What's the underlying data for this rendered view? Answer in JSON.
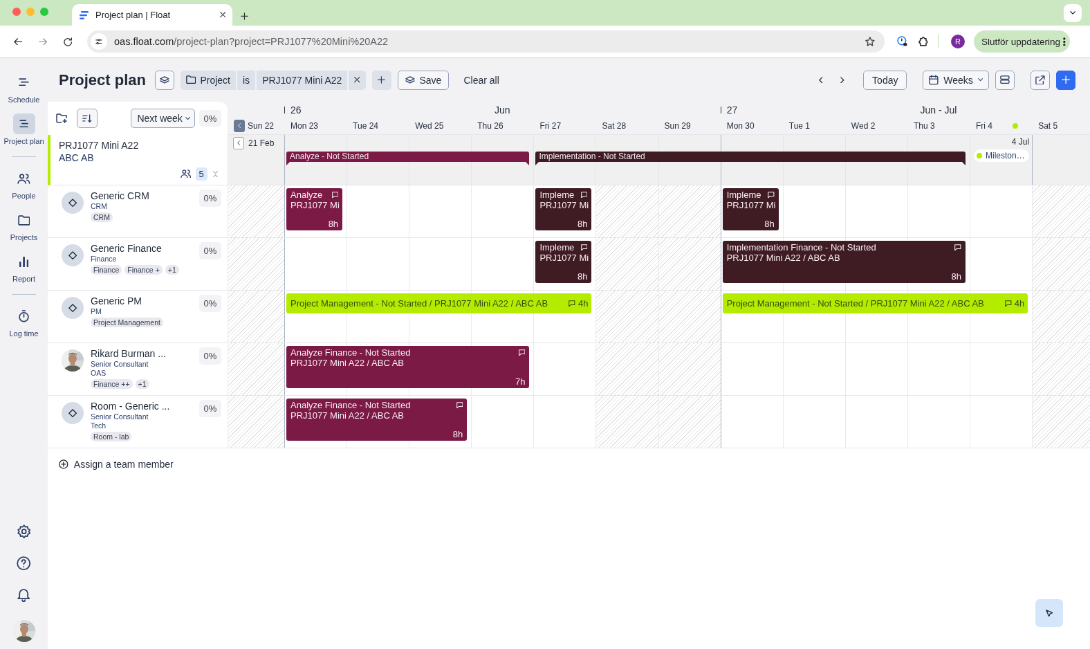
{
  "browser": {
    "tab_title": "Project plan | Float",
    "url_host": "oas.float.com",
    "url_path": "/project-plan?project=PRJ1077%20Mini%20A22",
    "profile_initial": "R",
    "update_button": "Slutför uppdatering"
  },
  "nav": {
    "groups": [
      [
        {
          "label": "Schedule",
          "selected": false
        },
        {
          "label": "Project plan",
          "selected": true
        }
      ],
      [
        {
          "label": "People",
          "selected": false
        },
        {
          "label": "Projects",
          "selected": false
        },
        {
          "label": "Report",
          "selected": false
        }
      ],
      [
        {
          "label": "Log time",
          "selected": false
        }
      ]
    ]
  },
  "header": {
    "title": "Project plan",
    "filter": {
      "field": "Project",
      "operator": "is",
      "value": "PRJ1077 Mini A22"
    },
    "save": "Save",
    "clear": "Clear all",
    "today": "Today",
    "view": "Weeks"
  },
  "panel": {
    "period": "Next week",
    "utilization": "0%",
    "assign": "Assign a team member"
  },
  "project": {
    "name": "PRJ1077 Mini A22",
    "client": "ABC AB",
    "member_count": "5"
  },
  "timeline": {
    "days": [
      {
        "label": "Sun 22",
        "weekend": true,
        "milestone": false
      },
      {
        "label": "Mon 23",
        "weekend": false,
        "milestone": false,
        "week": {
          "number": "26",
          "month": "Jun"
        }
      },
      {
        "label": "Tue 24",
        "weekend": false,
        "milestone": false
      },
      {
        "label": "Wed 25",
        "weekend": false,
        "milestone": false
      },
      {
        "label": "Thu 26",
        "weekend": false,
        "milestone": false
      },
      {
        "label": "Fri 27",
        "weekend": false,
        "milestone": false
      },
      {
        "label": "Sat 28",
        "weekend": true,
        "milestone": false
      },
      {
        "label": "Sun 29",
        "weekend": true,
        "milestone": false
      },
      {
        "label": "Mon 30",
        "weekend": false,
        "milestone": false,
        "week": {
          "number": "27",
          "month": "Jun - Jul"
        }
      },
      {
        "label": "Tue 1",
        "weekend": false,
        "milestone": false
      },
      {
        "label": "Wed 2",
        "weekend": false,
        "milestone": false
      },
      {
        "label": "Thu 3",
        "weekend": false,
        "milestone": false
      },
      {
        "label": "Fri 4",
        "weekend": false,
        "milestone": true
      },
      {
        "label": "Sat 5",
        "weekend": true,
        "milestone": false
      }
    ],
    "project_slots": [
      {
        "kind": "start",
        "label": "21 Feb"
      },
      {
        "kind": "phase",
        "title": "Analyze - Not Started",
        "color": "#7b1a45"
      },
      {
        "kind": "cont"
      },
      {
        "kind": "cont"
      },
      {
        "kind": "cont"
      },
      {
        "kind": "phase",
        "title": "Implementation - Not Started",
        "color": "#3f1c24"
      },
      {
        "kind": "cont"
      },
      {
        "kind": "cont"
      },
      {
        "kind": "cont"
      },
      {
        "kind": "cont"
      },
      {
        "kind": "cont"
      },
      {
        "kind": "cont"
      },
      {
        "kind": "end",
        "label": "4 Jul",
        "milestone": "Mileston…"
      },
      {
        "kind": "free"
      }
    ]
  },
  "people": [
    {
      "name": "Generic CRM",
      "role": "CRM",
      "kind": "placeholder",
      "tags": [
        "CRM"
      ],
      "utilization": "0%",
      "slots": [
        {
          "kind": "free"
        },
        {
          "kind": "block",
          "title": "Analyze",
          "subtitle": "PRJ1077 Mi",
          "hours": "8h",
          "comment": true,
          "color": "#7b1a45"
        },
        {
          "kind": "free"
        },
        {
          "kind": "free"
        },
        {
          "kind": "free"
        },
        {
          "kind": "block",
          "title": "Impleme",
          "subtitle": "PRJ1077 Mi",
          "hours": "8h",
          "comment": true,
          "color": "#3f1c24"
        },
        {
          "kind": "free"
        },
        {
          "kind": "free"
        },
        {
          "kind": "block",
          "title": "Impleme",
          "subtitle": "PRJ1077 Mi",
          "hours": "8h",
          "comment": true,
          "color": "#3f1c24"
        },
        {
          "kind": "free"
        },
        {
          "kind": "free"
        },
        {
          "kind": "free"
        },
        {
          "kind": "free"
        },
        {
          "kind": "free"
        }
      ]
    },
    {
      "name": "Generic Finance",
      "role": "Finance",
      "kind": "placeholder",
      "tags": [
        "Finance",
        "Finance +",
        "+1"
      ],
      "utilization": "0%",
      "slots": [
        {
          "kind": "free"
        },
        {
          "kind": "free"
        },
        {
          "kind": "free"
        },
        {
          "kind": "free"
        },
        {
          "kind": "free"
        },
        {
          "kind": "block",
          "title": "Impleme",
          "subtitle": "PRJ1077 Mi",
          "hours": "8h",
          "comment": true,
          "color": "#3f1c24"
        },
        {
          "kind": "free"
        },
        {
          "kind": "free"
        },
        {
          "kind": "block",
          "title": "Implementation Finance - Not Started",
          "subtitle": "PRJ1077 Mini A22 / ABC AB",
          "hours": "8h",
          "comment": true,
          "color": "#3f1c24"
        },
        {
          "kind": "cont"
        },
        {
          "kind": "cont"
        },
        {
          "kind": "cont"
        },
        {
          "kind": "free"
        },
        {
          "kind": "free"
        }
      ]
    },
    {
      "name": "Generic PM",
      "role": "PM",
      "kind": "placeholder",
      "tags": [
        "Project Management"
      ],
      "utilization": "0%",
      "slots": [
        {
          "kind": "free"
        },
        {
          "kind": "line",
          "title": "Project Management - Not Started / PRJ1077 Mini A22 / ABC AB",
          "hours": "4h",
          "comment": true,
          "color": "#b4ec00"
        },
        {
          "kind": "cont"
        },
        {
          "kind": "cont"
        },
        {
          "kind": "cont"
        },
        {
          "kind": "cont"
        },
        {
          "kind": "free"
        },
        {
          "kind": "free"
        },
        {
          "kind": "line",
          "title": "Project Management - Not Started / PRJ1077 Mini A22 / ABC AB",
          "hours": "4h",
          "comment": true,
          "color": "#b4ec00"
        },
        {
          "kind": "cont"
        },
        {
          "kind": "cont"
        },
        {
          "kind": "cont"
        },
        {
          "kind": "cont"
        },
        {
          "kind": "free"
        }
      ]
    },
    {
      "name": "Rikard Burman ...",
      "role": "Senior Consultant",
      "team": "OAS",
      "tags": [
        "Finance ++",
        "+1"
      ],
      "utilization": "0%",
      "slots": [
        {
          "kind": "free"
        },
        {
          "kind": "block",
          "title": "Analyze Finance - Not Started",
          "subtitle": "PRJ1077 Mini A22 / ABC AB",
          "hours": "7h",
          "comment": true,
          "color": "#7b1a45"
        },
        {
          "kind": "cont"
        },
        {
          "kind": "cont"
        },
        {
          "kind": "cont"
        },
        {
          "kind": "free"
        },
        {
          "kind": "free"
        },
        {
          "kind": "free"
        },
        {
          "kind": "free"
        },
        {
          "kind": "free"
        },
        {
          "kind": "free"
        },
        {
          "kind": "free"
        },
        {
          "kind": "free"
        },
        {
          "kind": "free"
        }
      ]
    },
    {
      "name": "Room - Generic ...",
      "role": "Senior Consultant",
      "team": "Tech",
      "kind": "placeholder",
      "tags": [
        "Room - lab"
      ],
      "utilization": "0%",
      "slots": [
        {
          "kind": "free"
        },
        {
          "kind": "block",
          "title": "Analyze Finance - Not Started",
          "subtitle": "PRJ1077 Mini A22 / ABC AB",
          "hours": "8h",
          "comment": true,
          "color": "#7b1a45"
        },
        {
          "kind": "cont"
        },
        {
          "kind": "cont"
        },
        {
          "kind": "free"
        },
        {
          "kind": "free"
        },
        {
          "kind": "free"
        },
        {
          "kind": "free"
        },
        {
          "kind": "free"
        },
        {
          "kind": "free"
        },
        {
          "kind": "free"
        },
        {
          "kind": "free"
        },
        {
          "kind": "free"
        },
        {
          "kind": "free"
        }
      ]
    }
  ]
}
